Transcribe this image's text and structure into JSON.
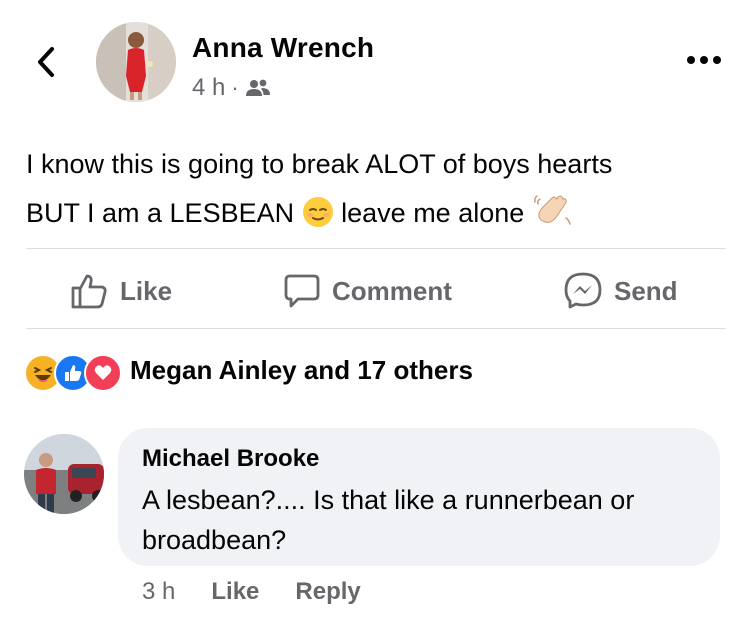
{
  "post": {
    "author": "Anna Wrench",
    "time": "4 h",
    "separator": "·",
    "audience_icon": "friends-icon",
    "text_line1": "I know this is going to break ALOT of boys hearts",
    "text_line2_before": "BUT I am a LESBEAN",
    "text_line2_after": "leave me alone",
    "emojis": [
      "relieved-face-emoji",
      "waving-hand-emoji"
    ]
  },
  "actions": {
    "like": "Like",
    "comment": "Comment",
    "send": "Send"
  },
  "reactions": {
    "icons": [
      "laugh-reaction-icon",
      "like-reaction-icon",
      "love-reaction-icon"
    ],
    "summary": "Megan Ainley and 17 others"
  },
  "comment": {
    "author": "Michael Brooke",
    "text": "A lesbean?.... Is that like a runnerbean or broadbean?",
    "time": "3 h",
    "like": "Like",
    "reply": "Reply"
  },
  "colors": {
    "text_primary": "#050505",
    "text_secondary": "#65676b",
    "divider": "#dadde1",
    "bubble": "#f0f2f5",
    "like_blue": "#1877f2",
    "love_red": "#f33e58",
    "haha_yellow": "#f7b125"
  }
}
